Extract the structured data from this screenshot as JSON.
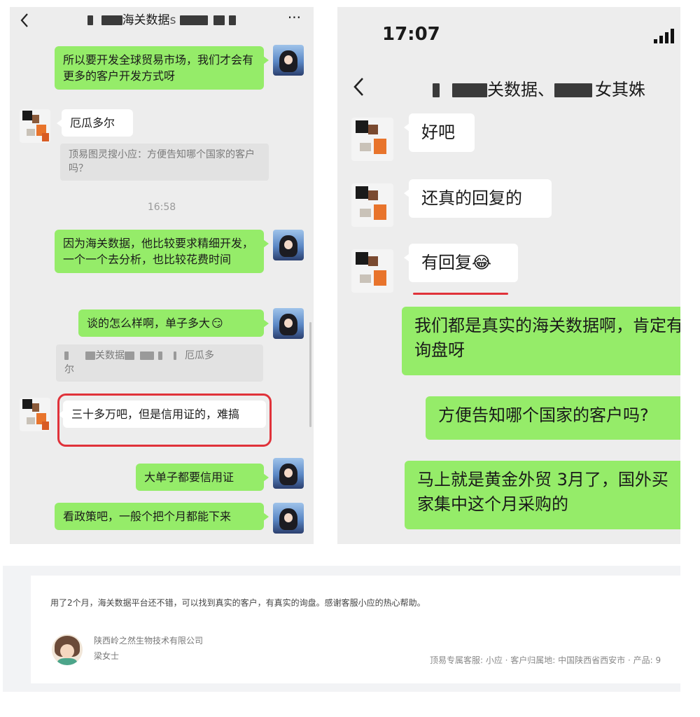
{
  "left": {
    "header": {
      "back_icon": "chevron-left-icon",
      "title_text": "海关数据",
      "title_suffix": "s",
      "more_icon": "more-dots-icon",
      "more_glyph": "···"
    },
    "messages": [
      {
        "text": "所以要开发全球贸易市场，我们才会有更多的客户开发方式呀"
      },
      {
        "text": "厄瓜多尔"
      },
      {
        "quote": "顶易图灵搜小应：方便告知哪个国家的客户吗？"
      },
      {
        "time": "16:58"
      },
      {
        "text": "因为海关数据，他比较要求精细开发，一个一个去分析，也比较花费时间"
      },
      {
        "text": "谈的怎么样啊，单子多大",
        "emoji": "😏"
      },
      {
        "quote_a": "关数据",
        "quote_b": "厄瓜多",
        "quote_c": "尔"
      },
      {
        "text": "三十多万吧，但是信用证的，难搞",
        "highlighted": true
      },
      {
        "text": "大单子都要信用证"
      },
      {
        "text": "看政策吧，一般个把个月都能下来"
      }
    ]
  },
  "right": {
    "status_time": "17:07",
    "signal_icon": "signal-bars-icon",
    "header": {
      "back_icon": "chevron-left-icon",
      "title_a": "关数据、",
      "title_b": "女其姝"
    },
    "messages": [
      {
        "text": "好吧"
      },
      {
        "text": "还真的回复的"
      },
      {
        "text": "有回复",
        "emoji": "😂",
        "underlined": true
      },
      {
        "text": "我们都是真实的海关数据啊，肯定有询盘呀"
      },
      {
        "text": "方便告知哪个国家的客户吗?"
      },
      {
        "text": "马上就是黄金外贸 3月了，国外买家集中这个月采购的"
      }
    ]
  },
  "review": {
    "comment": "用了2个月，海关数据平台还不错，可以找到真实的客户，有真实的询盘。感谢客服小应的热心帮助。",
    "company": "陕西岭之然生物技术有限公司",
    "name": "梁女士",
    "meta": "顶易专属客服: 小应  ·  客户归属地: 中国陕西省西安市  · 产品: 9"
  },
  "colors": {
    "wechat_green": "#95ec69",
    "chat_background": "#ededed",
    "highlight_red": "#e0323a"
  }
}
